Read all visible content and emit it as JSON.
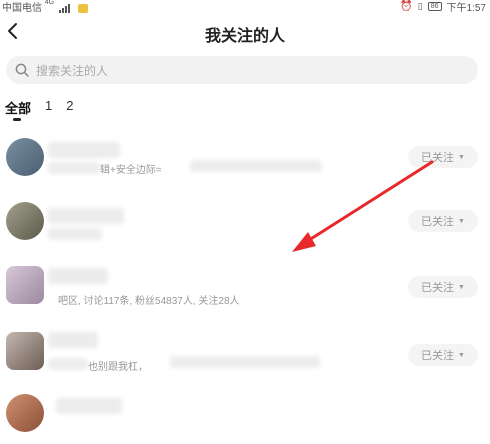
{
  "status_bar": {
    "carrier": "中国电信",
    "network": "4G",
    "battery": "86",
    "time": "下午1:57"
  },
  "header": {
    "title": "我关注的人"
  },
  "search": {
    "placeholder": "搜索关注的人"
  },
  "tabs": [
    {
      "label": "全部",
      "active": true
    },
    {
      "label": "1",
      "active": false
    },
    {
      "label": "2",
      "active": false
    }
  ],
  "list": [
    {
      "desc_text": "辑+安全边际=",
      "follow_label": "已关注"
    },
    {
      "desc_text": "",
      "follow_label": "已关注"
    },
    {
      "desc_text": "吧区, 讨论117条, 粉丝54837人, 关注28人",
      "follow_label": "已关注"
    },
    {
      "desc_text": "也别跟我杠，",
      "follow_label": "已关注"
    }
  ],
  "colors": {
    "annotation_arrow": "#e8282b",
    "follow_button_bg": "#f4f4f4"
  }
}
